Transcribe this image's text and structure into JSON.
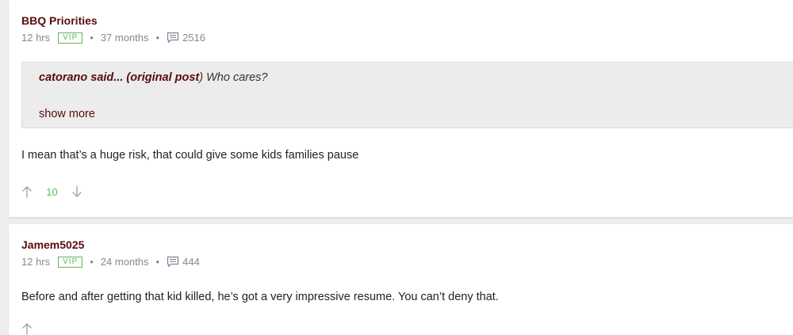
{
  "posts": [
    {
      "username": "BBQ Priorities",
      "time": "12 hrs",
      "badge": "VIP",
      "tenure": "37 months",
      "post_count": "2516",
      "quote": {
        "author": "catorano said...",
        "link": "(original post",
        "close": ")",
        "text": "Who cares?",
        "show_more": "show more"
      },
      "body": "I mean that’s a huge risk, that could give some kids families pause",
      "votes": "10"
    },
    {
      "username": "Jamem5025",
      "time": "12 hrs",
      "badge": "VIP",
      "tenure": "24 months",
      "post_count": "444",
      "body": "Before and after getting that kid killed, he’s got a very impressive resume. You can’t deny that."
    }
  ],
  "icons": {
    "comments": "chat-bubble-icon",
    "upvote": "arrow-up-icon",
    "downvote": "arrow-down-icon"
  },
  "colors": {
    "username": "#5a0c0c",
    "vip": "#5cb85c",
    "meta": "#808a94",
    "vote_count": "#5cb85c"
  }
}
